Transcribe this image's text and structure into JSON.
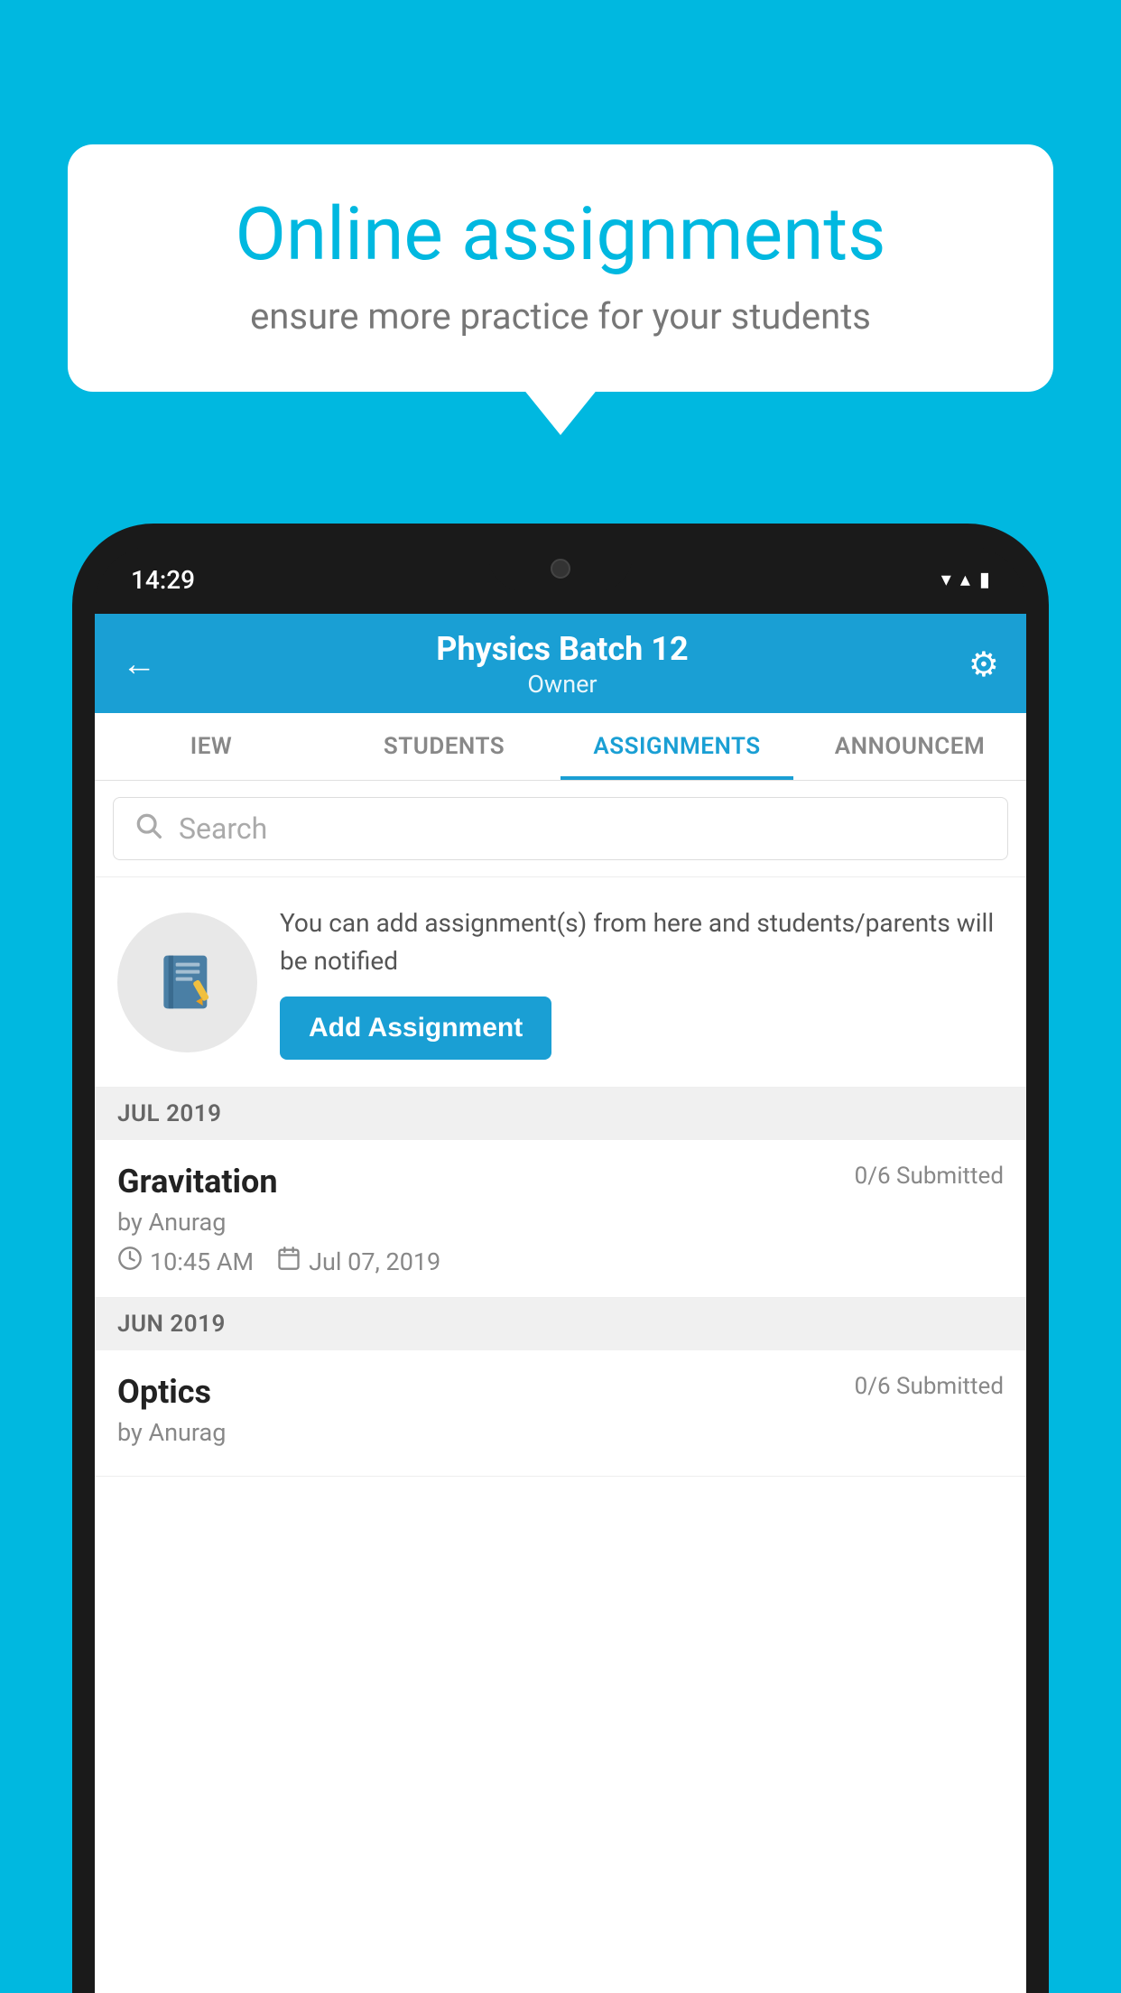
{
  "background_color": "#00b8e0",
  "speech_bubble": {
    "title": "Online assignments",
    "subtitle": "ensure more practice for your students"
  },
  "phone": {
    "status_bar": {
      "time": "14:29",
      "wifi_icon": "▼",
      "signal_icon": "▲",
      "battery_icon": "▮"
    },
    "header": {
      "title": "Physics Batch 12",
      "subtitle": "Owner",
      "back_label": "←",
      "settings_label": "⚙"
    },
    "tabs": [
      {
        "label": "IEW",
        "active": false
      },
      {
        "label": "STUDENTS",
        "active": false
      },
      {
        "label": "ASSIGNMENTS",
        "active": true
      },
      {
        "label": "ANNOUNCEM",
        "active": false
      }
    ],
    "search": {
      "placeholder": "Search"
    },
    "promo_card": {
      "description": "You can add assignment(s) from here and students/parents will be notified",
      "button_label": "Add Assignment"
    },
    "sections": [
      {
        "month": "JUL 2019",
        "assignments": [
          {
            "title": "Gravitation",
            "submitted": "0/6 Submitted",
            "author": "by Anurag",
            "time": "10:45 AM",
            "date": "Jul 07, 2019"
          }
        ]
      },
      {
        "month": "JUN 2019",
        "assignments": [
          {
            "title": "Optics",
            "submitted": "0/6 Submitted",
            "author": "by Anurag",
            "time": "",
            "date": ""
          }
        ]
      }
    ]
  }
}
